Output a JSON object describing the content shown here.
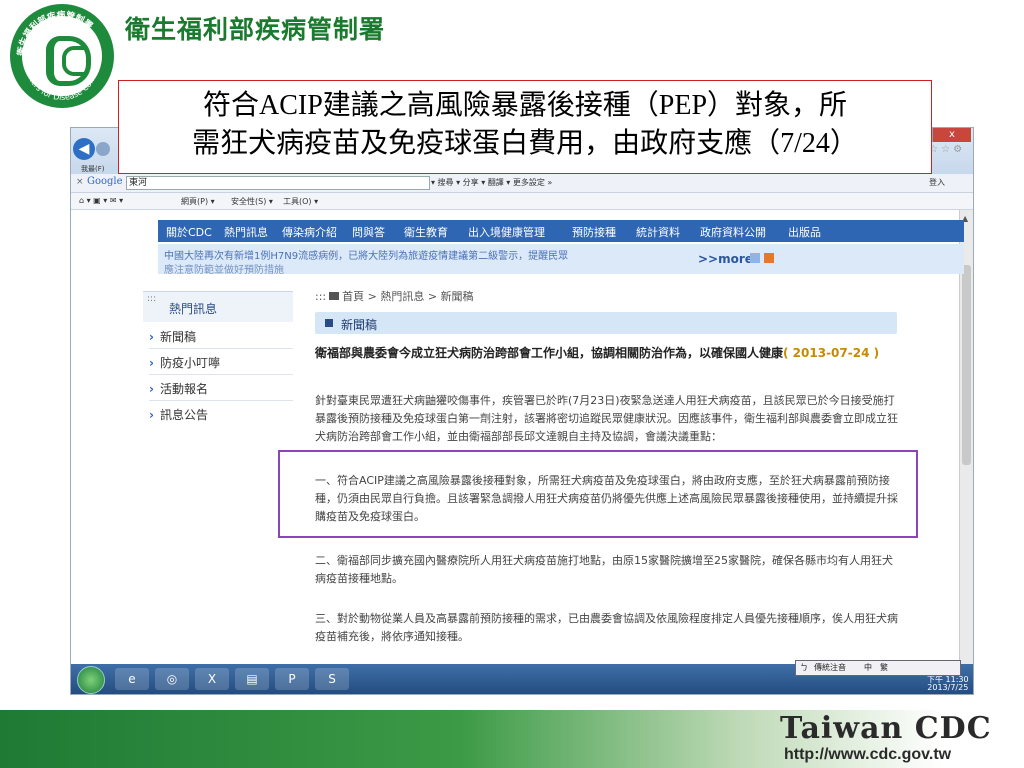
{
  "org_name": "衛生福利部疾病管制署",
  "logo": {
    "cn": "衛生福利部疾病管制署",
    "en": "Centers for Disease Control"
  },
  "slide_title": {
    "line1": "符合ACIP建議之高風險暴露後接種（PEP）對象，所",
    "line2": "需狂犬病疫苗及免疫球蛋白費用，由政府支應（7/24）"
  },
  "browser": {
    "favorites_label": "我最(F)",
    "search_bar": {
      "close": "×",
      "engine": "Google",
      "query": "東河",
      "tools": "▾ 搜尋 ▾ 分享 ▾ 翻譯 ▾ 更多設定 »",
      "signin": "登入"
    },
    "command_bar": [
      "網頁(P) ▾",
      "安全性(S) ▾",
      "工具(O) ▾"
    ],
    "window_buttons": {
      "min": "–",
      "close": "x"
    }
  },
  "site": {
    "nav": [
      "關於CDC",
      "熱門訊息",
      "傳染病介紹",
      "問與答",
      "衛生教育",
      "出入境健康管理",
      "預防接種",
      "統計資料",
      "政府資料公開",
      "出版品"
    ],
    "ticker_line1": "中國大陸再次有新增1例H7N9流感病例，已將大陸列為旅遊疫情建議第二級警示，提醒民眾",
    "ticker_line2": "應注意防範並做好預防措施",
    "more": ">>more",
    "sidebar": {
      "dots": ":::",
      "title": "熱門訊息",
      "items": [
        "新聞稿",
        "防疫小叮嚀",
        "活動報名",
        "訊息公告"
      ]
    },
    "breadcrumb": {
      "dots": ":::",
      "home": "首頁",
      "sep1": ">",
      "level1": "熱門訊息",
      "sep2": ">",
      "level2": "新聞稿"
    },
    "section_title": "新聞稿",
    "headline": "衛福部與農委會今成立狂犬病防治跨部會工作小組，協調相關防治作為，以確保國人健康",
    "headline_date": "( 2013-07-24 )",
    "paragraphs": [
      "針對臺東民眾遭狂犬病鼬獾咬傷事件，疾管署已於昨(7月23日)夜緊急送達人用狂犬病疫苗，且該民眾已於今日接受施打暴露後預防接種及免疫球蛋白第一劑注射，該署將密切追蹤民眾健康狀況。因應該事件，衛生福利部與農委會立即成立狂犬病防治跨部會工作小組，並由衛福部部長邱文達親自主持及協調，會議決議重點：",
      "一、符合ACIP建議之高風險暴露後接種對象，所需狂犬病疫苗及免疫球蛋白，將由政府支應，至於狂犬病暴露前預防接種，仍須由民眾自行負擔。且該署緊急調撥人用狂犬病疫苗仍將優先供應上述高風險民眾暴露後接種使用，並持續提升採購疫苗及免疫球蛋白。",
      "二、衛福部同步擴充國內醫療院所人用狂犬病疫苗施打地點，由原15家醫院擴增至25家醫院，確保各縣市均有人用狂犬病疫苗接種地點。",
      "三、對於動物從業人員及高暴露前預防接種的需求，已由農委會協調及依風險程度排定人員優先接種順序，俟人用狂犬病疫苗補充後，將依序通知接種。"
    ]
  },
  "taskbar": {
    "apps": [
      "e",
      "◎",
      "X",
      "▤",
      "P",
      "S"
    ],
    "ime": [
      "ㄅ",
      "傳統注音",
      "中",
      "繁"
    ],
    "clock_time": "下午 11:30",
    "clock_date": "2013/7/25"
  },
  "footer": {
    "brand": "Taiwan CDC",
    "url": "http://www.cdc.gov.tw"
  },
  "colors": {
    "brand_green": "#1e8a3c",
    "nav_blue": "#2e66b3",
    "highlight_purple": "#8a46b8",
    "title_border_red": "#cc2222"
  }
}
